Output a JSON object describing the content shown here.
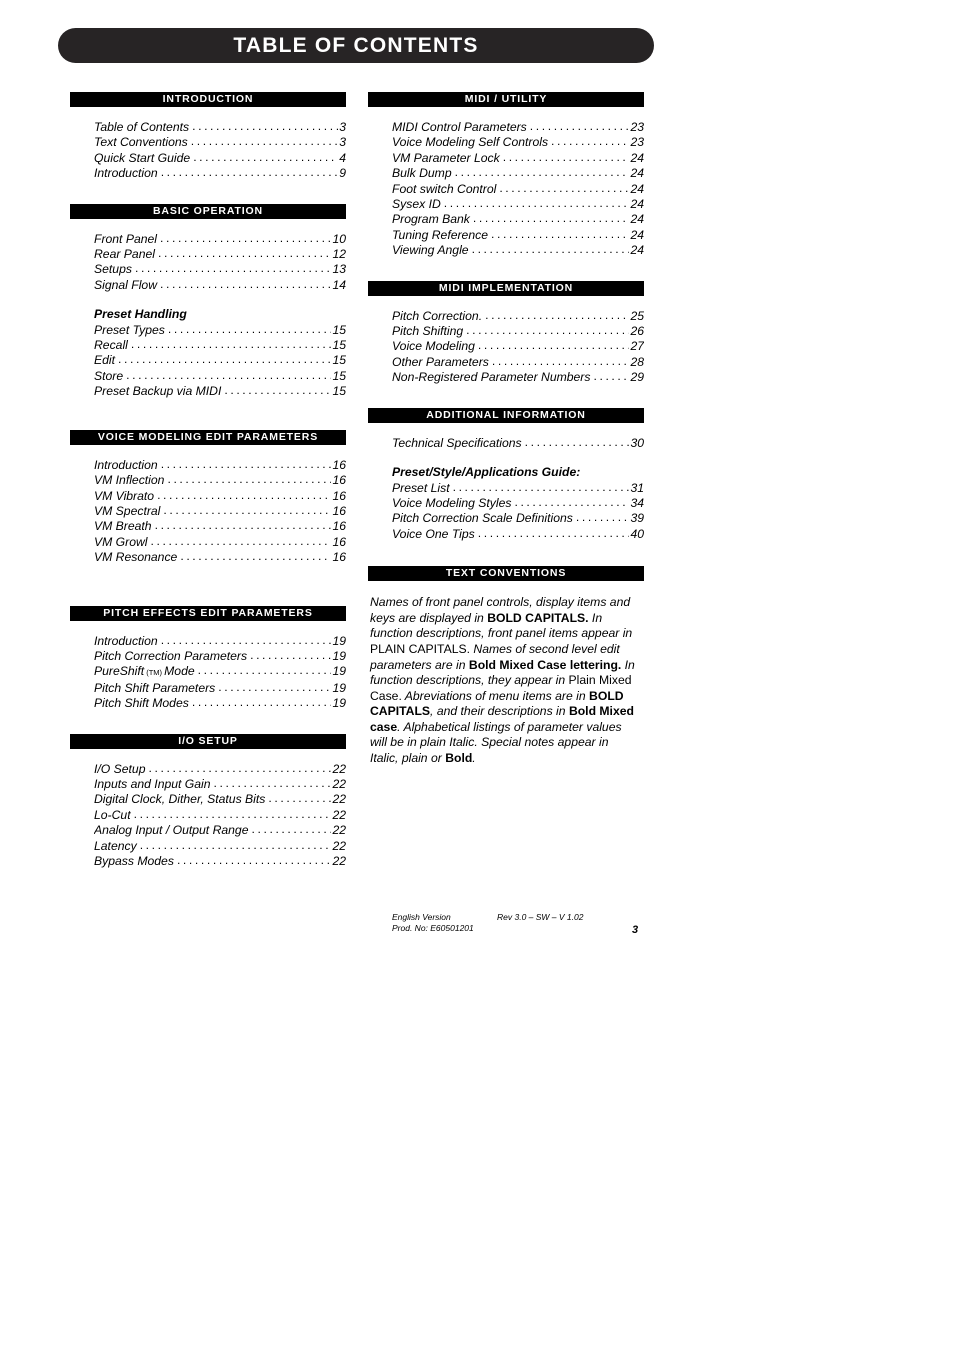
{
  "page": {
    "title": "TABLE OF CONTENTS",
    "page_number": "3"
  },
  "left_column": [
    {
      "header": "INTRODUCTION",
      "entries": [
        {
          "label": "Table of Contents",
          "page": "3"
        },
        {
          "label": "Text Conventions",
          "page": "3"
        },
        {
          "label": "Quick Start Guide",
          "page": "4"
        },
        {
          "label": "Introduction",
          "page": "9"
        }
      ]
    },
    {
      "header": "BASIC OPERATION",
      "entries": [
        {
          "label": "Front Panel",
          "page": "10"
        },
        {
          "label": "Rear Panel",
          "page": "12"
        },
        {
          "label": "Setups",
          "page": "13"
        },
        {
          "label": "Signal Flow",
          "page": "14"
        }
      ],
      "subsection": {
        "title": "Preset Handling",
        "entries": [
          {
            "label": "Preset Types",
            "page": "15"
          },
          {
            "label": "Recall",
            "page": "15"
          },
          {
            "label": "Edit",
            "page": "15"
          },
          {
            "label": "Store",
            "page": "15"
          },
          {
            "label": "Preset Backup via MIDI",
            "page": "15"
          }
        ]
      }
    },
    {
      "header": "VOICE MODELING EDIT PARAMETERS",
      "entries": [
        {
          "label": "Introduction",
          "page": "16"
        },
        {
          "label": "VM Inflection",
          "page": "16"
        },
        {
          "label": "VM Vibrato",
          "page": "16"
        },
        {
          "label": "VM Spectral",
          "page": "16"
        },
        {
          "label": "VM Breath",
          "page": "16"
        },
        {
          "label": "VM Growl",
          "page": "16"
        },
        {
          "label": "VM Resonance",
          "page": "16"
        }
      ]
    },
    {
      "header": "PITCH EFFECTS EDIT PARAMETERS",
      "entries": [
        {
          "label": "Introduction",
          "page": "19"
        },
        {
          "label": "Pitch Correction Parameters",
          "page": "19"
        },
        {
          "label": "PureShift",
          "label_tm": "(TM)",
          "label_tail": "Mode",
          "page": "19"
        },
        {
          "label": "Pitch Shift Parameters",
          "page": "19"
        },
        {
          "label": "Pitch Shift Modes",
          "page": "19"
        }
      ]
    },
    {
      "header": "I/O SETUP",
      "entries": [
        {
          "label": "I/O Setup",
          "page": "22"
        },
        {
          "label": "Inputs and Input Gain",
          "page": "22"
        },
        {
          "label": "Digital Clock, Dither, Status Bits",
          "page": "22"
        },
        {
          "label": "Lo-Cut",
          "page": "22"
        },
        {
          "label": "Analog Input / Output Range",
          "page": "22"
        },
        {
          "label": "Latency",
          "page": "22"
        },
        {
          "label": "Bypass Modes",
          "page": "22"
        }
      ]
    }
  ],
  "right_column": [
    {
      "header": "MIDI / UTILITY",
      "entries": [
        {
          "label": "MIDI Control Parameters",
          "page": "23"
        },
        {
          "label": "Voice Modeling Self Controls",
          "page": "23"
        },
        {
          "label": "VM Parameter Lock",
          "page": "24"
        },
        {
          "label": "Bulk Dump",
          "page": "24"
        },
        {
          "label": "Foot switch Control",
          "page": "24"
        },
        {
          "label": "Sysex ID",
          "page": "24"
        },
        {
          "label": "Program Bank",
          "page": "24"
        },
        {
          "label": "Tuning Reference",
          "page": "24"
        },
        {
          "label": "Viewing Angle",
          "page": "24"
        }
      ]
    },
    {
      "header": "MIDI IMPLEMENTATION",
      "entries": [
        {
          "label": "Pitch Correction.",
          "page": "25"
        },
        {
          "label": "Pitch Shifting",
          "page": "26"
        },
        {
          "label": "Voice Modeling",
          "page": "27"
        },
        {
          "label": "Other Parameters",
          "page": "28"
        },
        {
          "label": "Non-Registered Parameter Numbers",
          "page": "29"
        }
      ]
    },
    {
      "header": "ADDITIONAL INFORMATION",
      "entries": [
        {
          "label": "Technical Specifications",
          "page": "30"
        }
      ],
      "subsection": {
        "title": "Preset/Style/Applications Guide:",
        "entries": [
          {
            "label": "Preset List",
            "page": "31"
          },
          {
            "label": "Voice Modeling Styles",
            "page": "34"
          },
          {
            "label": "Pitch Correction Scale Definitions",
            "page": "39"
          },
          {
            "label": "Voice One Tips",
            "page": "40"
          }
        ]
      }
    },
    {
      "header": "TEXT CONVENTIONS",
      "paragraph": {
        "s1": "Names of front panel controls, display items and keys are displayed in ",
        "b1": "BOLD CAPITALS.",
        "s2": " In function descriptions, front panel items appear in ",
        "p1": "PLAIN CAPITALS.",
        "s3": " Names of second level edit parameters are in ",
        "b2": "Bold Mixed Case lettering.",
        "s4": " In function descriptions, they appear in ",
        "p2": "Plain Mixed Case.",
        "s5": " Abreviations of menu items are in ",
        "b3": "BOLD CAPITALS",
        "s6": ", and their descriptions in ",
        "b4": "Bold Mixed case",
        "s7": ". Alphabetical listings of parameter values will be in plain Italic. Special notes appear in Italic, plain or ",
        "b5": "Bold",
        "s8": "."
      }
    }
  ],
  "footer": {
    "english_version": "English Version",
    "rev": "Rev 3.0 – SW – V 1.02",
    "prod_no": "Prod. No: E60501201"
  }
}
